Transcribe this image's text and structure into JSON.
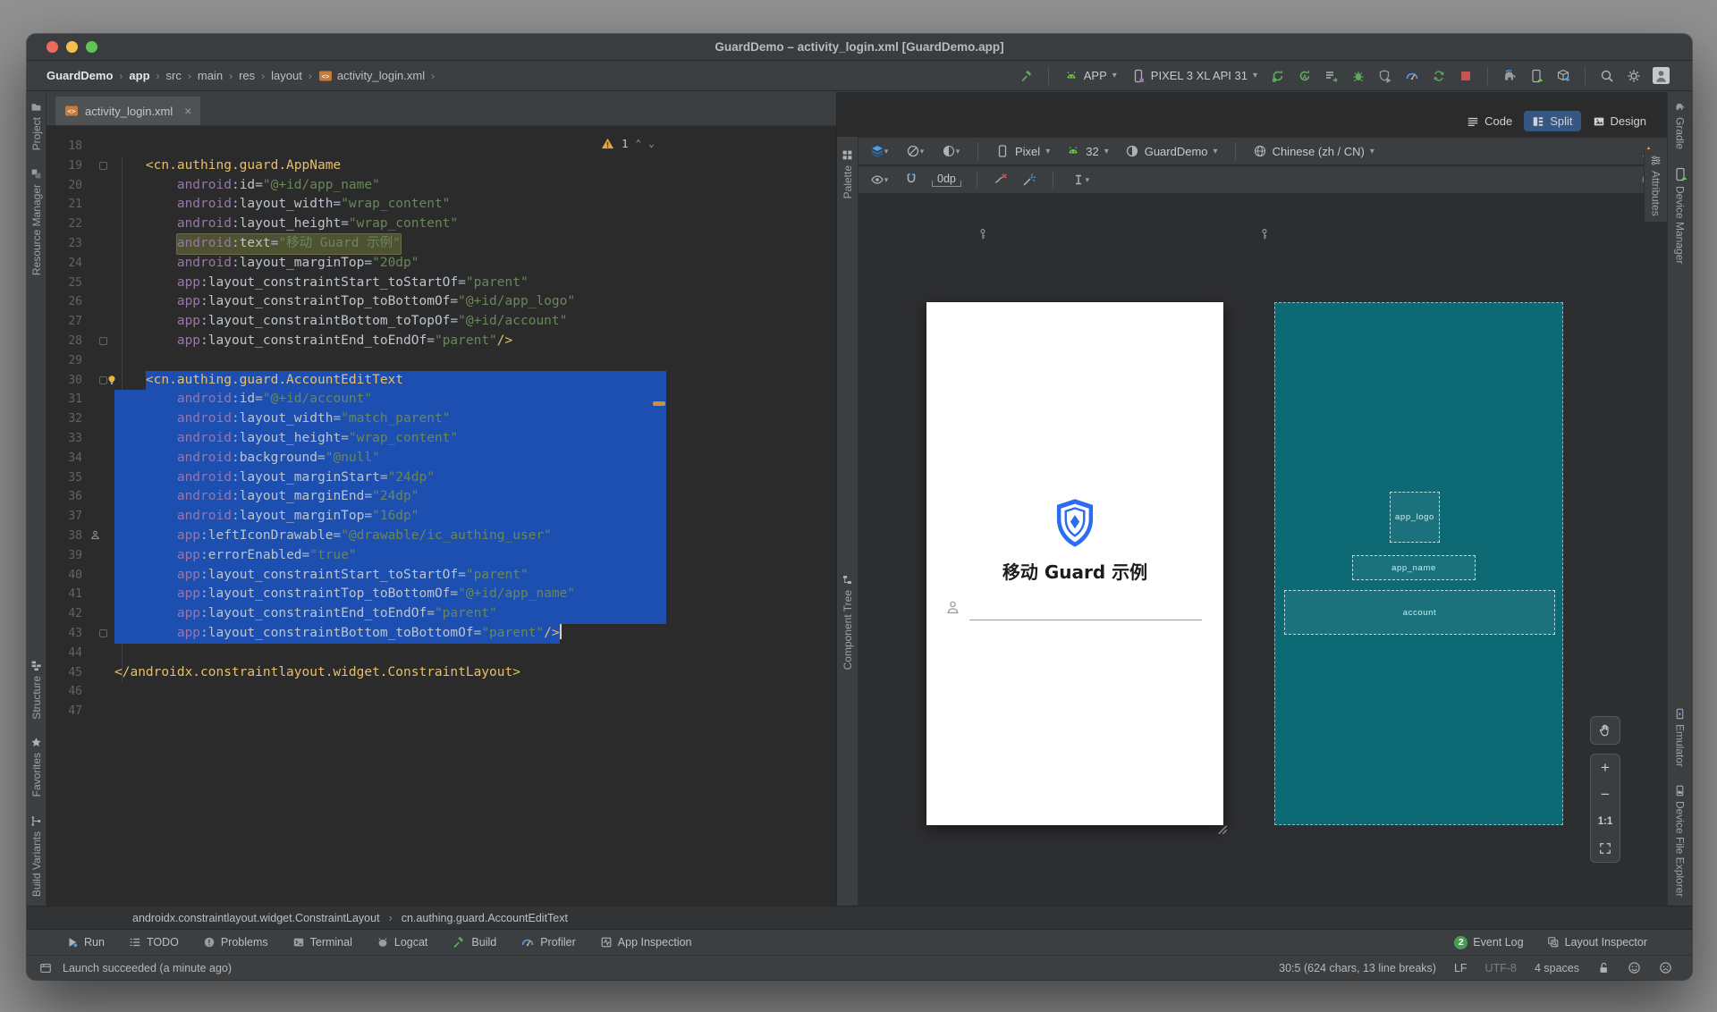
{
  "window": {
    "title": "GuardDemo – activity_login.xml [GuardDemo.app]"
  },
  "breadcrumb": {
    "items": [
      {
        "label": "GuardDemo",
        "bold": true
      },
      {
        "label": "app",
        "bold": true
      },
      {
        "label": "src",
        "bold": false
      },
      {
        "label": "main",
        "bold": false
      },
      {
        "label": "res",
        "bold": false
      },
      {
        "label": "layout",
        "bold": false
      },
      {
        "label": "activity_login.xml",
        "bold": false,
        "icon": "xmlfile"
      }
    ],
    "trailing_sep": "›"
  },
  "run_toolbar": {
    "build_button": {
      "name": "build-hammer-button",
      "icon": "hammer"
    },
    "run_config": {
      "label": "APP",
      "icon": "androidhead"
    },
    "device_select": {
      "label": "PIXEL 3 XL API 31",
      "icon": "phonedev"
    },
    "actions": [
      {
        "name": "rerun-button",
        "icon": "rerun"
      },
      {
        "name": "apply-changes-button",
        "icon": "applyA"
      },
      {
        "name": "apply-code-changes-button",
        "icon": "applylines"
      },
      {
        "name": "debug-button",
        "icon": "bug"
      },
      {
        "name": "attach-debugger-button",
        "icon": "shieldplay"
      },
      {
        "name": "profile-button",
        "icon": "gauge"
      },
      {
        "name": "rerun-tests-button",
        "icon": "syncstar"
      },
      {
        "name": "stop-button",
        "icon": "stop"
      }
    ],
    "tool_actions": [
      {
        "name": "gradle-sync-button",
        "icon": "elephant"
      },
      {
        "name": "device-manager-button",
        "icon": "devmgr"
      },
      {
        "name": "sdk-manager-button",
        "icon": "sdkbox"
      }
    ],
    "global_actions": [
      {
        "name": "search-everywhere-button",
        "icon": "search"
      },
      {
        "name": "settings-button",
        "icon": "gear"
      },
      {
        "name": "profile-avatar",
        "icon": "avatar"
      }
    ]
  },
  "editor": {
    "tab": {
      "label": "activity_login.xml",
      "close": "×"
    },
    "warning": {
      "count": "1"
    },
    "code_lines": [
      {
        "n": 18
      },
      {
        "n": 19,
        "ind": 4,
        "tag": "<cn.authing.guard.AppName",
        "f": true
      },
      {
        "n": 20,
        "ind": 8,
        "ns": "android",
        "a": "id",
        "v": "@+id/app_name"
      },
      {
        "n": 21,
        "ind": 8,
        "ns": "android",
        "a": "layout_width",
        "v": "wrap_content"
      },
      {
        "n": 22,
        "ind": 8,
        "ns": "android",
        "a": "layout_height",
        "v": "wrap_content"
      },
      {
        "n": 23,
        "ind": 8,
        "ns": "android",
        "a": "text",
        "v": "移动 Guard 示例",
        "hl": true
      },
      {
        "n": 24,
        "ind": 8,
        "ns": "android",
        "a": "layout_marginTop",
        "v": "20dp"
      },
      {
        "n": 25,
        "ind": 8,
        "ns": "app",
        "a": "layout_constraintStart_toStartOf",
        "v": "parent"
      },
      {
        "n": 26,
        "ind": 8,
        "ns": "app",
        "a": "layout_constraintTop_toBottomOf",
        "v": "@+id/app_logo"
      },
      {
        "n": 27,
        "ind": 8,
        "ns": "app",
        "a": "layout_constraintBottom_toTopOf",
        "v": "@+id/account"
      },
      {
        "n": 28,
        "ind": 8,
        "ns": "app",
        "a": "layout_constraintEnd_toEndOf",
        "v": "parent",
        "end": "/>",
        "f": true
      },
      {
        "n": 29
      },
      {
        "n": 30,
        "ind": 4,
        "tag": "<cn.authing.guard.AccountEditText",
        "sel": "start",
        "g": "bulb",
        "f": true
      },
      {
        "n": 31,
        "ind": 8,
        "ns": "android",
        "a": "id",
        "v": "@+id/account",
        "sel": "full"
      },
      {
        "n": 32,
        "ind": 8,
        "ns": "android",
        "a": "layout_width",
        "v": "match_parent",
        "sel": "full"
      },
      {
        "n": 33,
        "ind": 8,
        "ns": "android",
        "a": "layout_height",
        "v": "wrap_content",
        "sel": "full"
      },
      {
        "n": 34,
        "ind": 8,
        "ns": "android",
        "a": "background",
        "v": "@null",
        "sel": "full"
      },
      {
        "n": 35,
        "ind": 8,
        "ns": "android",
        "a": "layout_marginStart",
        "v": "24dp",
        "sel": "full"
      },
      {
        "n": 36,
        "ind": 8,
        "ns": "android",
        "a": "layout_marginEnd",
        "v": "24dp",
        "sel": "full"
      },
      {
        "n": 37,
        "ind": 8,
        "ns": "android",
        "a": "layout_marginTop",
        "v": "16dp",
        "sel": "full"
      },
      {
        "n": 38,
        "ind": 8,
        "ns": "app",
        "a": "leftIconDrawable",
        "v": "@drawable/ic_authing_user",
        "sel": "full",
        "g": "person"
      },
      {
        "n": 39,
        "ind": 8,
        "ns": "app",
        "a": "errorEnabled",
        "v": "true",
        "sel": "full"
      },
      {
        "n": 40,
        "ind": 8,
        "ns": "app",
        "a": "layout_constraintStart_toStartOf",
        "v": "parent",
        "sel": "full"
      },
      {
        "n": 41,
        "ind": 8,
        "ns": "app",
        "a": "layout_constraintTop_toBottomOf",
        "v": "@+id/app_name",
        "sel": "full"
      },
      {
        "n": 42,
        "ind": 8,
        "ns": "app",
        "a": "layout_constraintEnd_toEndOf",
        "v": "parent",
        "sel": "full"
      },
      {
        "n": 43,
        "ind": 8,
        "ns": "app",
        "a": "layout_constraintBottom_toBottomOf",
        "v": "parent",
        "end": "/>",
        "sel": "end",
        "f": true
      },
      {
        "n": 44
      },
      {
        "n": 45,
        "ind": 0,
        "tag": "</androidx.constraintlayout.widget.ConstraintLayout>"
      },
      {
        "n": 46
      },
      {
        "n": 47
      }
    ],
    "breadcrumb_items": [
      "androidx.constraintlayout.widget.ConstraintLayout",
      "cn.authing.guard.AccountEditText"
    ]
  },
  "design": {
    "mode_tabs": [
      {
        "label": "Code",
        "icon": "codeic",
        "active": false
      },
      {
        "label": "Split",
        "icon": "splitic",
        "active": true
      },
      {
        "label": "Design",
        "icon": "designic",
        "active": false
      }
    ],
    "surface_buttons": [
      {
        "name": "view-mode-button",
        "icon": "layers"
      },
      {
        "name": "orientation-button",
        "icon": "orientation"
      },
      {
        "name": "night-mode-button",
        "icon": "themec"
      }
    ],
    "dropdowns": [
      {
        "name": "device-select",
        "icon": "phonesm",
        "label": "Pixel"
      },
      {
        "name": "api-select",
        "icon": "androidhead",
        "label": "32"
      },
      {
        "name": "theme-select",
        "icon": "themedot",
        "label": "GuardDemo"
      },
      {
        "name": "locale-select",
        "icon": "globe",
        "label": "Chinese (zh / CN)"
      }
    ],
    "toolbar2": {
      "margin_value": "0dp",
      "buttons_left": [
        {
          "name": "view-options-button",
          "icon": "eye"
        },
        {
          "name": "autoconnect-button",
          "icon": "magnet"
        }
      ],
      "buttons_right": [
        {
          "name": "clear-constraints-button",
          "icon": "delcon"
        },
        {
          "name": "infer-constraints-button",
          "icon": "wand"
        }
      ],
      "pack_button": {
        "name": "pack-button",
        "icon": "ibeam"
      }
    },
    "palette_label": "Palette",
    "component_tree_label": "Component Tree",
    "attributes_label": "Attributes",
    "preview": {
      "app_title": "移动 Guard 示例"
    },
    "blueprint_boxes": [
      {
        "id": "bp-logo",
        "label": "app_logo"
      },
      {
        "id": "bp-name",
        "label": "app_name"
      },
      {
        "id": "bp-account",
        "label": "account"
      }
    ],
    "zoom_controls": {
      "one_to_one": "1:1"
    }
  },
  "left_strip": {
    "top": [
      {
        "label": "Project",
        "icon": "proj"
      },
      {
        "label": "Resource Manager",
        "icon": "resmgr"
      }
    ],
    "bottom": [
      {
        "label": "Structure",
        "icon": "struct"
      },
      {
        "label": "Favorites",
        "icon": "star"
      },
      {
        "label": "Build Variants",
        "icon": "buildvar"
      }
    ]
  },
  "right_strip": {
    "top": [
      {
        "label": "Gradle",
        "icon": "gradle"
      },
      {
        "label": "Device Manager",
        "icon": "devmgr"
      }
    ],
    "bottom": [
      {
        "label": "Emulator",
        "icon": "emu"
      },
      {
        "label": "Device File Explorer",
        "icon": "dfe"
      }
    ]
  },
  "bottom_tools": {
    "left": [
      {
        "label": "Run",
        "icon": "runplay"
      },
      {
        "label": "TODO",
        "icon": "todo"
      },
      {
        "label": "Problems",
        "icon": "problem"
      },
      {
        "label": "Terminal",
        "icon": "terminal"
      },
      {
        "label": "Logcat",
        "icon": "logcat"
      },
      {
        "label": "Build",
        "icon": "hammer"
      },
      {
        "label": "Profiler",
        "icon": "gauge"
      },
      {
        "label": "App Inspection",
        "icon": "inspect"
      }
    ],
    "right": [
      {
        "label": "Event Log",
        "icon": "eventbadge",
        "badge": "2"
      },
      {
        "label": "Layout Inspector",
        "icon": "layinsp"
      }
    ]
  },
  "status_bar": {
    "left_text": "Launch succeeded (a minute ago)",
    "position": "30:5 (624 chars, 13 line breaks)",
    "line_ending": "LF",
    "encoding": "UTF-8",
    "indent": "4 spaces"
  },
  "colors": {
    "selection_blue": "#1d4fb0",
    "blueprint_teal": "#0d6a75",
    "tag_gold": "#e8bf6a",
    "string_green": "#6a8759",
    "namespace_purple": "#9876aa",
    "warning_orange": "#e8a33d",
    "run_green": "#5caa5c",
    "stop_red": "#c75450",
    "shield_blue": "#2b6cf0",
    "split_tab_blue": "#365880"
  }
}
